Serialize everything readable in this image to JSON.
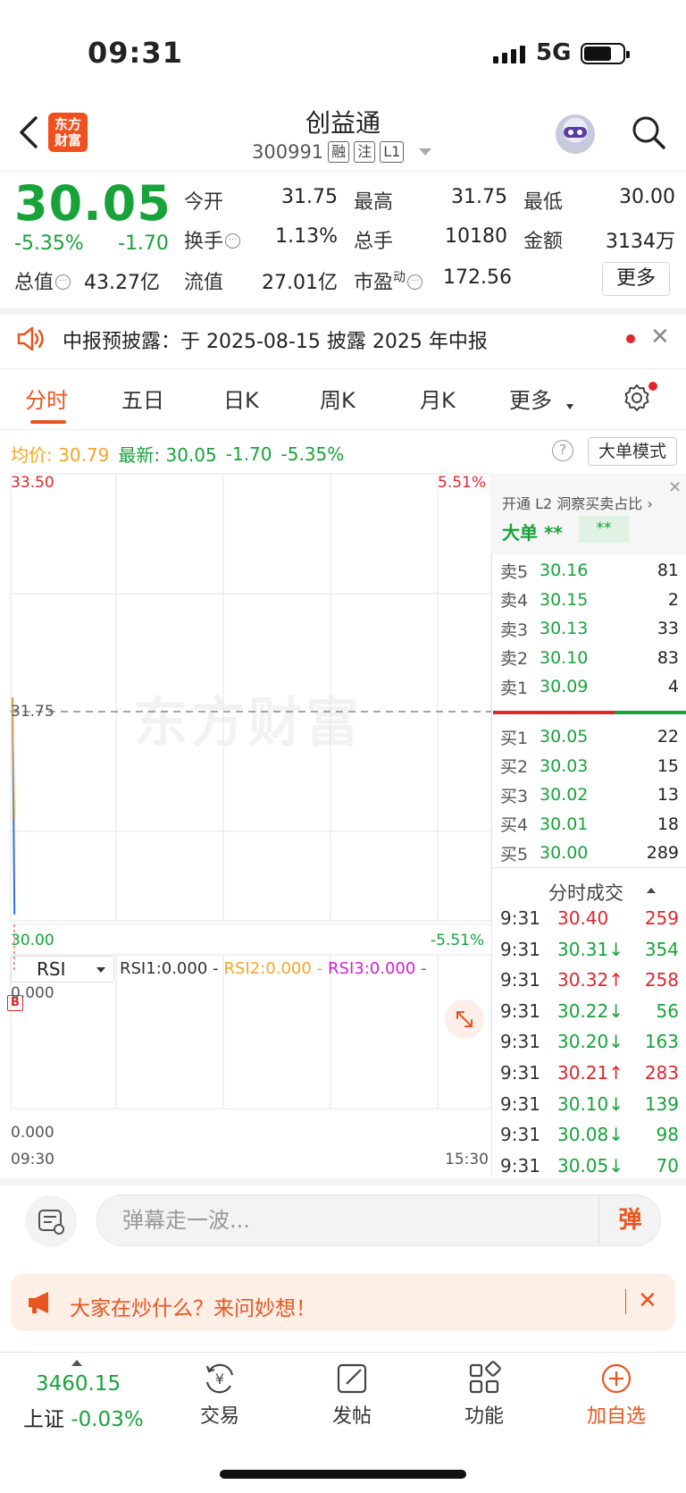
{
  "status_bar": {
    "time": "09:31",
    "network": "5G"
  },
  "header": {
    "logo_text": "东方财富",
    "title": "创益通",
    "code": "300991",
    "tags": [
      "融",
      "注",
      "L1"
    ]
  },
  "quote": {
    "price": "30.05",
    "change_pct": "-5.35%",
    "change_abs": "-1.70",
    "stats": [
      {
        "label": "今开",
        "value": "31.75",
        "color": "#222"
      },
      {
        "label": "最高",
        "value": "31.75",
        "color": "#222"
      },
      {
        "label": "最低",
        "value": "30.00",
        "color": "#17a33a"
      },
      {
        "label": "换手",
        "value": "1.13%",
        "color": "#222"
      },
      {
        "label": "总手",
        "value": "10180",
        "color": "#222"
      },
      {
        "label": "金额",
        "value": "3134万",
        "color": "#222"
      }
    ],
    "total_value_label": "总值",
    "total_value": "43.27亿",
    "float_value_label": "流值",
    "float_value": "27.01亿",
    "pe_label": "市盈",
    "pe_sup": "动",
    "pe_value": "172.56",
    "more_label": "更多"
  },
  "notice": {
    "text": "中报预披露：于 2025-08-15 披露 2025 年中报"
  },
  "tabs": [
    "分时",
    "五日",
    "日K",
    "周K",
    "月K",
    "更多"
  ],
  "avg_line": {
    "avg_label": "均价:",
    "avg_value": "30.79",
    "latest_label": "最新:",
    "latest_value": "30.05",
    "latest_abs": "-1.70",
    "latest_pct": "-5.35%",
    "big_mode": "大单模式"
  },
  "chart": {
    "y_top": "33.50",
    "y_mid": "31.75",
    "y_bottom": "30.00",
    "pct_top": "5.51%",
    "pct_bottom": "-5.51%",
    "rsi_top": "0.000",
    "rsi_bottom": "0.000",
    "x_start": "09:30",
    "x_end": "15:30",
    "watermark": "东方财富"
  },
  "chart_data": {
    "type": "line",
    "x": [
      "09:30",
      "09:31"
    ],
    "series": [
      {
        "values": [
          31.75,
          30.05
        ],
        "color": "#2f6fde"
      },
      {
        "values": [
          31.75,
          30.79
        ],
        "color": "#f5a623"
      }
    ],
    "ylim": [
      30.0,
      33.5
    ],
    "xlim": [
      "09:30",
      "15:30"
    ],
    "grid": true
  },
  "rsi": {
    "selector": "RSI",
    "rsi1": "RSI1:0.000 -",
    "rsi2": "RSI2:0.000 -",
    "rsi3": "RSI3:0.000 -",
    "badge": "B"
  },
  "l2": {
    "title": "开通 L2 洞察买卖占比 ›",
    "big_label": "大单",
    "big_val": "**",
    "big_box": "**"
  },
  "order_book": {
    "asks": [
      {
        "label": "卖5",
        "price": "30.16",
        "vol": "81"
      },
      {
        "label": "卖4",
        "price": "30.15",
        "vol": "2"
      },
      {
        "label": "卖3",
        "price": "30.13",
        "vol": "33"
      },
      {
        "label": "卖2",
        "price": "30.10",
        "vol": "83"
      },
      {
        "label": "卖1",
        "price": "30.09",
        "vol": "4"
      }
    ],
    "bids": [
      {
        "label": "买1",
        "price": "30.05",
        "vol": "22"
      },
      {
        "label": "买2",
        "price": "30.03",
        "vol": "15"
      },
      {
        "label": "买3",
        "price": "30.02",
        "vol": "13"
      },
      {
        "label": "买4",
        "price": "30.01",
        "vol": "18"
      },
      {
        "label": "买5",
        "price": "30.00",
        "vol": "289"
      }
    ]
  },
  "ticks": {
    "header": "分时成交",
    "rows": [
      {
        "time": "9:31",
        "price": "30.40",
        "vol": "259",
        "vol_color": "#e0262d"
      },
      {
        "time": "9:31",
        "price": "30.31↓",
        "vol": "354",
        "vol_color": "#17a33a"
      },
      {
        "time": "9:31",
        "price": "30.32↑",
        "vol": "258",
        "vol_color": "#e0262d"
      },
      {
        "time": "9:31",
        "price": "30.22↓",
        "vol": "56",
        "vol_color": "#17a33a"
      },
      {
        "time": "9:31",
        "price": "30.20↓",
        "vol": "163",
        "vol_color": "#17a33a"
      },
      {
        "time": "9:31",
        "price": "30.21↑",
        "vol": "283",
        "vol_color": "#e0262d"
      },
      {
        "time": "9:31",
        "price": "30.10↓",
        "vol": "139",
        "vol_color": "#17a33a"
      },
      {
        "time": "9:31",
        "price": "30.08↓",
        "vol": "98",
        "vol_color": "#17a33a"
      },
      {
        "time": "9:31",
        "price": "30.05↓",
        "vol": "70",
        "vol_color": "#17a33a"
      }
    ]
  },
  "danmaku": {
    "placeholder": "弹幕走一波...",
    "button": "弹"
  },
  "ask_banner": {
    "text": "大家在炒什么？来问妙想！"
  },
  "bottom_nav": {
    "index_value": "3460.15",
    "index_name": "上证",
    "index_change": "-0.03%",
    "items": [
      "交易",
      "发帖",
      "功能",
      "加自选"
    ]
  },
  "colors": {
    "accent": "#e8551f",
    "down": "#17a33a",
    "up": "#e0262d"
  }
}
